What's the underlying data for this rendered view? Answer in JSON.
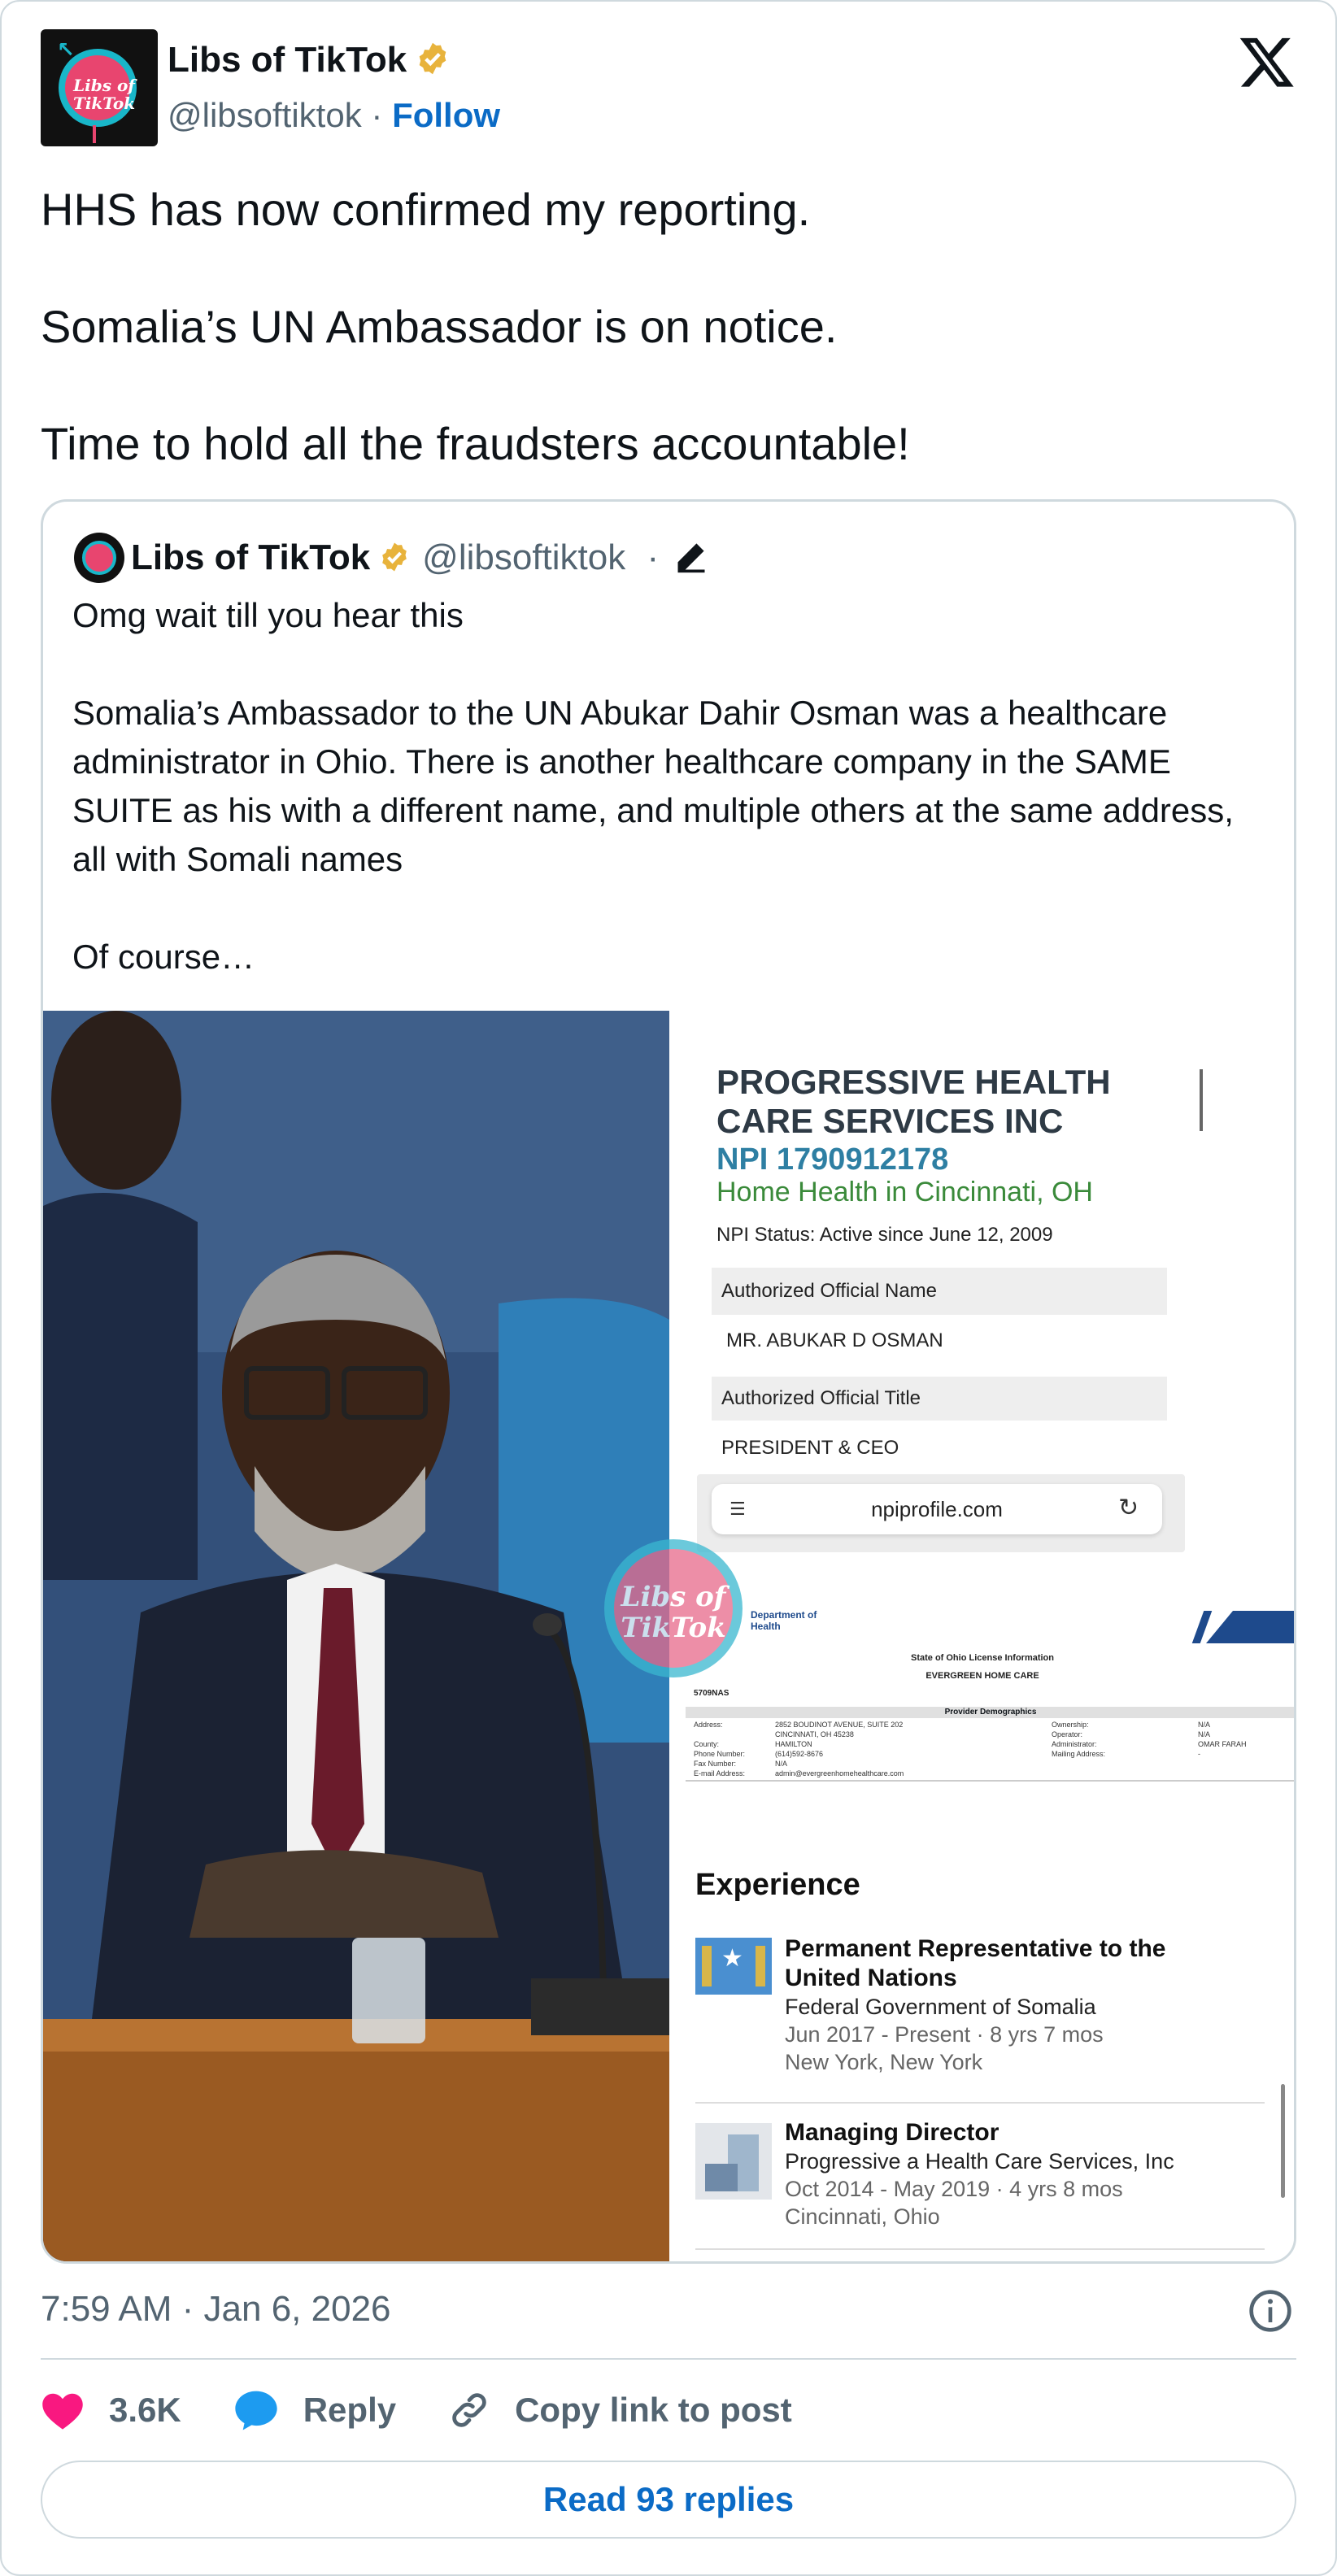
{
  "author": {
    "name": "Libs of TikTok",
    "handle": "@libsoftiktok",
    "separator": "·",
    "follow_label": "Follow",
    "logo_text_line1": "Libs of",
    "logo_text_line2": "TikTok"
  },
  "tweet": {
    "paragraphs": [
      "HHS has now confirmed my reporting.",
      "Somalia’s UN Ambassador is on notice.",
      "Time to hold all the fraudsters accountable!"
    ],
    "timestamp": "7:59 AM · Jan 6, 2026"
  },
  "quoted": {
    "name": "Libs of TikTok",
    "handle": "@libsoftiktok",
    "separator": "·",
    "paragraphs": [
      "Omg wait till you hear this",
      "Somalia’s Ambassador to the UN Abukar Dahir Osman was a healthcare administrator in Ohio. There is another healthcare company in the SAME SUITE as his with a different name, and multiple others at the same address, all with Somali names",
      "Of course…"
    ],
    "image": {
      "company_line1": "PROGRESSIVE HEALTH",
      "company_line2": "CARE SERVICES INC",
      "npi": "NPI 1790912178",
      "category": "Home Health in Cincinnati, OH",
      "npi_status": "NPI Status: Active since June 12, 2009",
      "official_name_label": "Authorized Official Name",
      "official_name": "MR. ABUKAR D OSMAN",
      "official_title_label": "Authorized Official Title",
      "official_title": "PRESIDENT & CEO",
      "url": "npiprofile.com",
      "dept_line1": "Department of",
      "dept_line2": "Health",
      "license_title": "State of Ohio License Information",
      "license_company": "EVERGREEN HOME CARE",
      "license_id": "5709NAS",
      "provider_demographics": "Provider Demographics",
      "demo_left": [
        [
          "Address:",
          "2852 BOUDINOT AVENUE, SUITE 202"
        ],
        [
          "",
          "CINCINNATI, OH 45238"
        ],
        [
          "County:",
          "HAMILTON"
        ],
        [
          "Phone Number:",
          "(614)592-8676"
        ],
        [
          "Fax Number:",
          "N/A"
        ],
        [
          "E-mail Address:",
          "admin@evergreenhomehealthcare.com"
        ]
      ],
      "demo_right": [
        [
          "Ownership:",
          "N/A"
        ],
        [
          "Operator:",
          "N/A"
        ],
        [
          "Administrator:",
          "OMAR FARAH"
        ],
        [
          "Mailing Address:",
          "-"
        ]
      ],
      "experience_heading": "Experience",
      "experience": [
        {
          "title_line1": "Permanent Representative to the",
          "title_line2": "United Nations",
          "org": "Federal Government of Somalia",
          "dates": "Jun 2017 - Present · 8 yrs 7 mos",
          "location": "New York, New York"
        },
        {
          "title_line1": "Managing Director",
          "title_line2": "",
          "org": "Progressive a Health Care Services, Inc",
          "dates": "Oct 2014 - May 2019 · 4 yrs 8 mos",
          "location": "Cincinnati, Ohio"
        }
      ]
    }
  },
  "actions": {
    "likes": "3.6K",
    "reply_label": "Reply",
    "copy_label": "Copy link to post",
    "read_replies_label": "Read 93 replies"
  },
  "colors": {
    "link_blue": "#0b6bc6",
    "like_pink": "#f91880",
    "reply_blue": "#1d9bf0",
    "gold_badge": "#e8b33c",
    "border": "#cfd9de",
    "secondary_text": "#536471"
  },
  "icons": [
    "verified-badge-icon",
    "x-logo-icon",
    "edit-pencil-icon",
    "info-icon",
    "heart-icon",
    "reply-bubble-icon",
    "link-icon",
    "reload-icon"
  ]
}
